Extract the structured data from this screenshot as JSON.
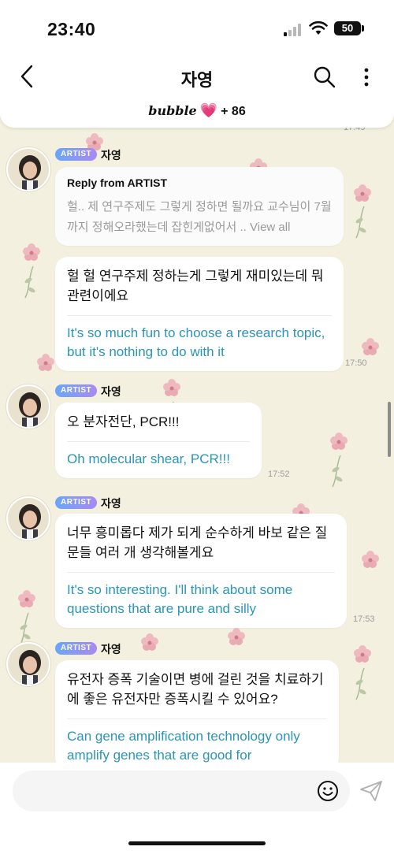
{
  "status_bar": {
    "time": "23:40",
    "battery": "50"
  },
  "header": {
    "title": "자영",
    "bubble_logo": "bubble",
    "heart": "💗",
    "plus_count": "+ 86"
  },
  "colors": {
    "translation_text": "#2a95b6",
    "artist_badge_start": "#6aa6f7",
    "artist_badge_end": "#a88af0",
    "background": "#f3f0df"
  },
  "messages": [
    {
      "badge": "ARTIST",
      "sender": "자영",
      "reply_title": "Reply from ARTIST",
      "reply_text": "헐.. 제 연구주제도 그렇게 정하면 될까요 교수님이 7월까지 정해오라했는데 잡힌게없어서 ..",
      "reply_more": "View all",
      "ko": "헐 헐 연구주제 정하는게 그렇게 재미있는데 뭐 관련이에요",
      "en": "It's so much fun to choose a research topic, but it's nothing to do with it",
      "time": "17:50"
    },
    {
      "badge": "ARTIST",
      "sender": "자영",
      "ko": "오 분자전단, PCR!!!",
      "en": "Oh molecular shear, PCR!!!",
      "time": "17:52"
    },
    {
      "badge": "ARTIST",
      "sender": "자영",
      "ko": "너무 흥미롭다 제가 되게 순수하게 바보 같은 질문들 여러 개 생각해볼게요",
      "en": "It's so interesting. I'll think about some questions that are pure and silly",
      "time": "17:53"
    },
    {
      "badge": "ARTIST",
      "sender": "자영",
      "ko": "유전자 증폭 기술이면 병에 걸린 것을 치료하기에 좋은 유전자만 증폭시킬 수 있어요?",
      "en": "Can gene amplification technology only amplify genes that are good for"
    }
  ],
  "partial_top_time": "17:49",
  "input": {
    "placeholder": ""
  },
  "icons": {
    "back": "chevron-left-icon",
    "search": "search-icon",
    "more": "more-vertical-icon",
    "emoji": "smiley-icon",
    "send": "send-icon"
  }
}
